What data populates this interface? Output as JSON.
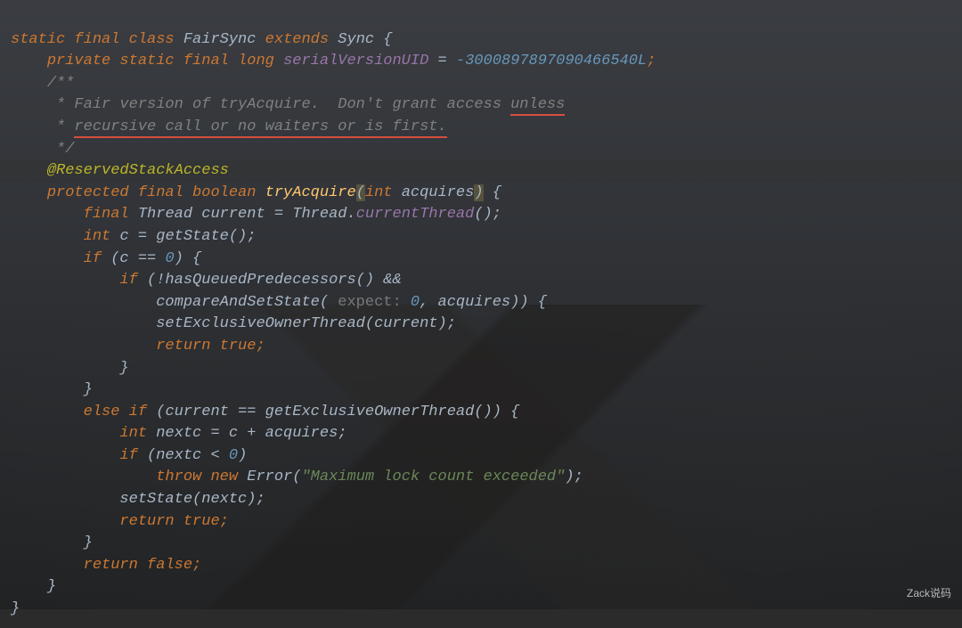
{
  "code": {
    "line1": {
      "kw1": "static final class",
      "cls": " FairSync ",
      "kw2": "extends",
      "ext": " Sync {"
    },
    "line2": {
      "kw": "private static final long ",
      "field": "serialVersionUID",
      "eq": " = ",
      "num": "-3000897897090466540L",
      "semi": ";"
    },
    "line3": "/**",
    "line4_pre": " * Fair version of tryAcquire.  Don't grant access ",
    "line4_ul": "unless",
    "line5_pre": " * ",
    "line5_ul": "recursive call or no waiters or is first.",
    "line6": " */",
    "line7": "@ReservedStackAccess",
    "line8": {
      "kw": "protected final boolean ",
      "method": "tryAcquire",
      "lpar": "(",
      "ptype": "int ",
      "pname": "acquires",
      "rpar": ")",
      "tail": " {"
    },
    "line9": {
      "kw": "final ",
      "type": "Thread current = Thread.",
      "call": "currentThread",
      "tail": "();"
    },
    "line10": {
      "kw": "int ",
      "txt": "c = getState();"
    },
    "line11": {
      "kw": "if ",
      "txt": "(c == ",
      "num": "0",
      "tail": ") {"
    },
    "line12": {
      "kw": "if ",
      "txt": "(!hasQueuedPredecessors() &&"
    },
    "line13": {
      "txt1": "compareAndSetState(",
      "hint": " expect: ",
      "num": "0",
      "txt2": ", acquires)) {"
    },
    "line14": "setExclusiveOwnerThread(current);",
    "line15": {
      "kw": "return true",
      "semi": ";"
    },
    "line16": "}",
    "line17": "}",
    "line18": {
      "kw1": "else if ",
      "txt": "(current == getExclusiveOwnerThread()) {"
    },
    "line19": {
      "kw": "int ",
      "txt": "nextc = c + acquires;"
    },
    "line20": {
      "kw": "if ",
      "txt": "(nextc < ",
      "num": "0",
      "tail": ")"
    },
    "line21": {
      "kw": "throw new ",
      "type": "Error(",
      "str": "\"Maximum lock count exceeded\"",
      "tail": ");"
    },
    "line22": "setState(nextc);",
    "line23": {
      "kw": "return true",
      "semi": ";"
    },
    "line24": "}",
    "line25": {
      "kw": "return false",
      "semi": ";"
    },
    "line26": "}",
    "line27": "}"
  },
  "watermark": "Zack说码"
}
